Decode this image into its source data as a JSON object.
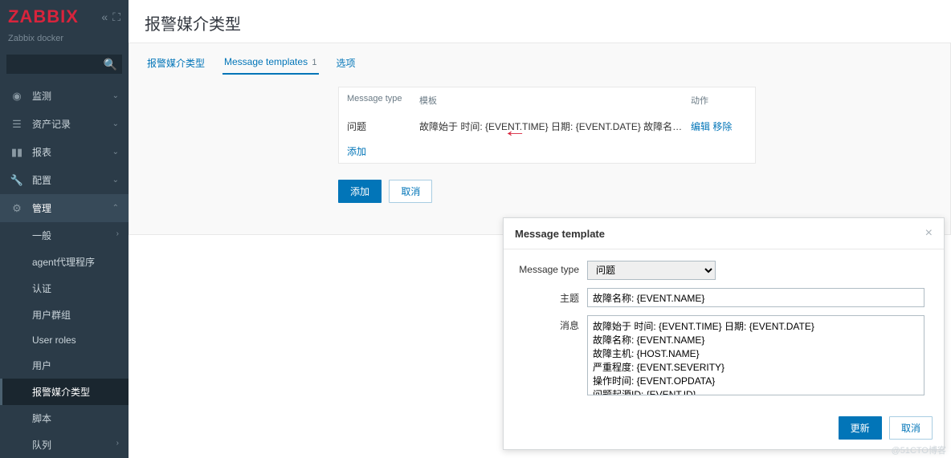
{
  "brand": {
    "name": "ZABBIX",
    "subtitle": "Zabbix docker"
  },
  "search": {
    "placeholder": ""
  },
  "nav": {
    "items": [
      {
        "label": "监测"
      },
      {
        "label": "资产记录"
      },
      {
        "label": "报表"
      },
      {
        "label": "配置"
      },
      {
        "label": "管理"
      }
    ],
    "sub": [
      {
        "label": "一般"
      },
      {
        "label": "agent代理程序"
      },
      {
        "label": "认证"
      },
      {
        "label": "用户群组"
      },
      {
        "label": "User roles"
      },
      {
        "label": "用户"
      },
      {
        "label": "报警媒介类型"
      },
      {
        "label": "脚本"
      },
      {
        "label": "队列"
      }
    ]
  },
  "page": {
    "title": "报警媒介类型"
  },
  "tabs": {
    "t1": "报警媒介类型",
    "t2": "Message templates",
    "t2_count": "1",
    "t3": "选项"
  },
  "table": {
    "h1": "Message type",
    "h2": "模板",
    "h3": "动作",
    "r1c1": "问题",
    "r1c2": "故障始于 时间: {EVENT.TIME} 日期: {EVENT.DATE} 故障名称: {...",
    "r1_edit": "编辑",
    "r1_remove": "移除",
    "add_link": "添加"
  },
  "buttons": {
    "add": "添加",
    "cancel": "取消"
  },
  "modal": {
    "title": "Message template",
    "l_type": "Message type",
    "v_type": "问题",
    "l_subject": "主题",
    "v_subject": "故障名称: {EVENT.NAME}",
    "l_message": "消息",
    "v_message": "故障始于 时间: {EVENT.TIME} 日期: {EVENT.DATE}\n故障名称: {EVENT.NAME}\n故障主机: {HOST.NAME}\n严重程度: {EVENT.SEVERITY}\n操作时间: {EVENT.OPDATA}\n问题起源ID: {EVENT.ID}",
    "btn_update": "更新",
    "btn_cancel": "取消"
  },
  "watermark": "@51CTO博客"
}
